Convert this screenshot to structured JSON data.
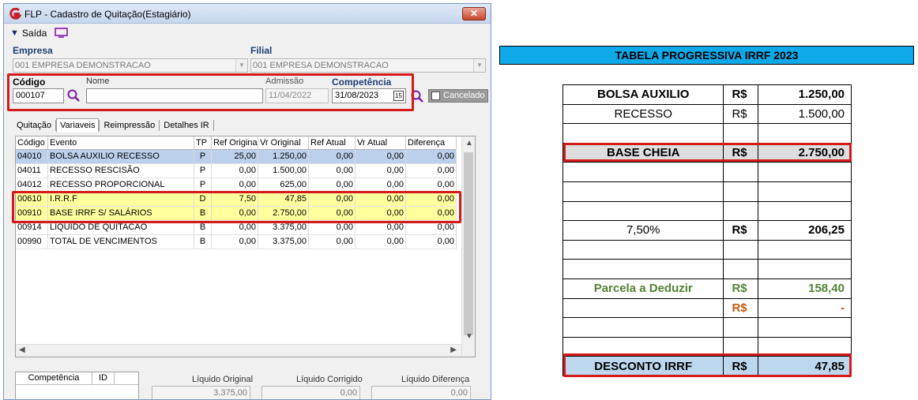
{
  "window": {
    "title": "FLP - Cadastro de Quitação(Estagiário)",
    "close": "✕"
  },
  "menu": {
    "exit": "Saída"
  },
  "form": {
    "empresa_label": "Empresa",
    "empresa_value": "001 EMPRESA DEMONSTRACAO",
    "filial_label": "Filial",
    "filial_value": "001 EMPRESA DEMONSTRACAO",
    "codigo_label": "Código",
    "codigo_value": "000107",
    "nome_label": "Nome",
    "nome_value": "",
    "admissao_label": "Admissão",
    "admissao_value": "11/04/2022",
    "competencia_label": "Competência",
    "competencia_value": "31/08/2023",
    "cancelado_label": "Cancelado",
    "calendar_day": "15"
  },
  "tabs": [
    "Quitação",
    "Variaveis",
    "Reimpressão",
    "Detalhes IR"
  ],
  "grid": {
    "columns": [
      "Código",
      "Evento",
      "TP",
      "Ref Original",
      "Vr Original",
      "Ref Atual",
      "Vr Atual",
      "Diferença"
    ],
    "rows": [
      [
        "04010",
        "BOLSA AUXILIO RECESSO",
        "P",
        "25,00",
        "1.250,00",
        "0,00",
        "0,00",
        "0,00"
      ],
      [
        "04011",
        "RECESSO RESCISÃO",
        "P",
        "0,00",
        "1.500,00",
        "0,00",
        "0,00",
        "0,00"
      ],
      [
        "04012",
        "RECESSO PROPORCIONAL",
        "P",
        "0,00",
        "625,00",
        "0,00",
        "0,00",
        "0,00"
      ],
      [
        "00610",
        "I.R.R.F",
        "D",
        "7,50",
        "47,85",
        "0,00",
        "0,00",
        "0,00"
      ],
      [
        "00910",
        "BASE IRRF S/ SALÁRIOS",
        "B",
        "0,00",
        "2.750,00",
        "0,00",
        "0,00",
        "0,00"
      ],
      [
        "00914",
        "LIQUIDO DE QUITACAO",
        "B",
        "0,00",
        "3.375,00",
        "0,00",
        "0,00",
        "0,00"
      ],
      [
        "00990",
        "TOTAL DE VENCIMENTOS",
        "B",
        "0,00",
        "3.375,00",
        "0,00",
        "0,00",
        "0,00"
      ]
    ]
  },
  "bottom": {
    "comp_headers": [
      "Competência",
      "ID"
    ],
    "liquido_original_label": "Líquido Original",
    "liquido_original_value": "3.375,00",
    "liquido_corrigido_label": "Líquido Corrigido",
    "liquido_corrigido_value": "0,00",
    "liquido_diferenca_label": "Líquido Diferença",
    "liquido_diferenca_value": "0,00"
  },
  "irrf_table": {
    "title": "TABELA PROGRESSIVA IRRF 2023",
    "rows": [
      {
        "label": "BOLSA AUXILIO",
        "cur": "R$",
        "value": "1.250,00",
        "style": "bold"
      },
      {
        "label": "RECESSO",
        "cur": "R$",
        "value": "1.500,00",
        "style": "normal"
      },
      {
        "label": "",
        "cur": "",
        "value": "",
        "style": "normal"
      },
      {
        "label": "BASE CHEIA",
        "cur": "R$",
        "value": "2.750,00",
        "style": "shaded"
      },
      {
        "label": "",
        "cur": "",
        "value": "",
        "style": "normal"
      },
      {
        "label": "",
        "cur": "",
        "value": "",
        "style": "normal"
      },
      {
        "label": "",
        "cur": "",
        "value": "",
        "style": "normal"
      },
      {
        "label": "7,50%",
        "cur": "R$",
        "value": "206,25",
        "style": "normal"
      },
      {
        "label": "",
        "cur": "",
        "value": "",
        "style": "normal"
      },
      {
        "label": "",
        "cur": "",
        "value": "",
        "style": "normal"
      },
      {
        "label": "Parcela a Deduzir",
        "cur": "R$",
        "value": "158,40",
        "style": "green"
      },
      {
        "label": "",
        "cur": "R$",
        "value": "-",
        "style": "orange"
      },
      {
        "label": "",
        "cur": "",
        "value": "",
        "style": "normal"
      },
      {
        "label": "",
        "cur": "",
        "value": "",
        "style": "normal"
      },
      {
        "label": "DESCONTO IRRF",
        "cur": "R$",
        "value": "47,85",
        "style": "blue"
      }
    ]
  },
  "colors": {
    "selected_row": "#bcd0ec",
    "highlight_row": "#ffff9e",
    "highlight_box": "#d41a1a",
    "banner": "#0fa8e8",
    "green_text": "#548235",
    "orange_text": "#c55a11"
  }
}
